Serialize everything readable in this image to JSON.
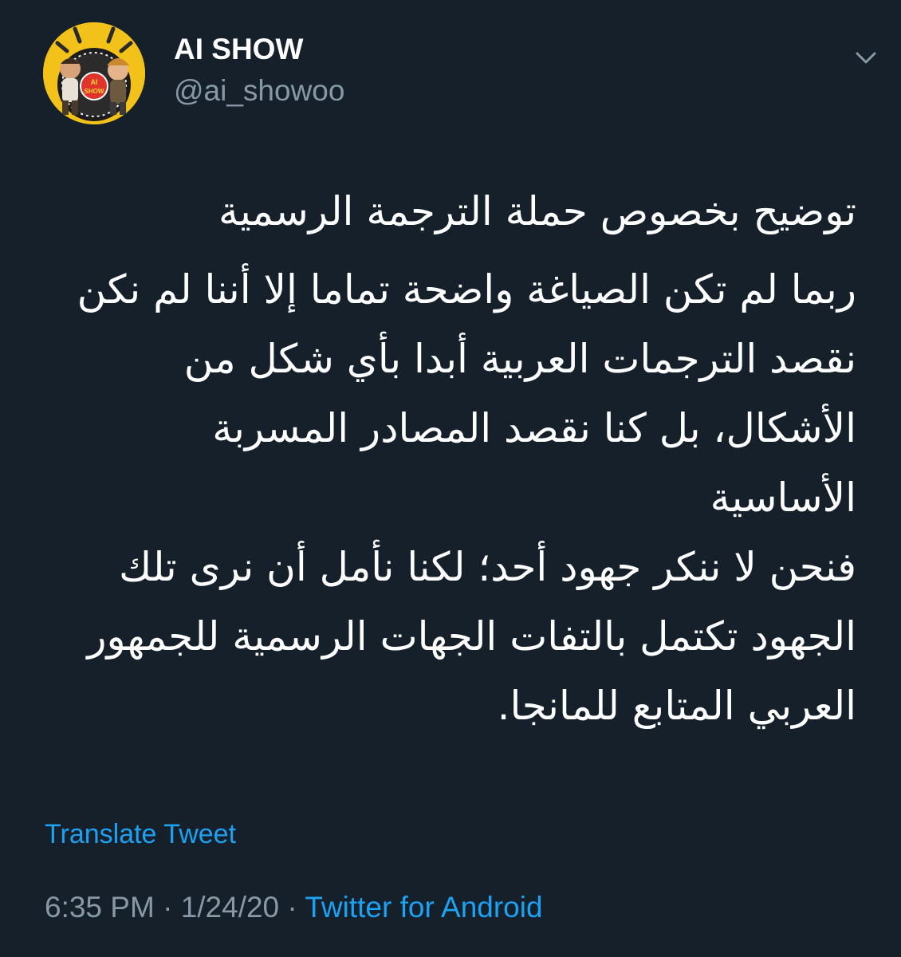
{
  "user": {
    "display_name": "AI SHOW",
    "handle": "@ai_showoo",
    "avatar_logo_text": "AI SHOW"
  },
  "tweet": {
    "paragraphs": [
      "توضيح بخصوص حملة الترجمة الرسمية",
      "ربما لم تكن الصياغة واضحة تماما إلا أننا لم نكن\nنقصد الترجمات العربية أبدا بأي شكل من\nالأشكال، بل كنا نقصد المصادر المسربة\nالأساسية\nفنحن لا ننكر جهود أحد؛ لكنا نأمل أن نرى تلك\nالجهود تكتمل بالتفات الجهات الرسمية للجمهور\nالعربي المتابع للمانجا."
    ],
    "translate_label": "Translate Tweet",
    "time": "6:35 PM",
    "separator": "·",
    "date": "1/24/20",
    "source": "Twitter for Android"
  },
  "icons": {
    "menu": "chevron-down-icon"
  },
  "colors": {
    "background": "#15202b",
    "text": "#ffffff",
    "secondary_text": "#8899a6",
    "link": "#1da1f2",
    "avatar_bg": "#f2c21b"
  }
}
